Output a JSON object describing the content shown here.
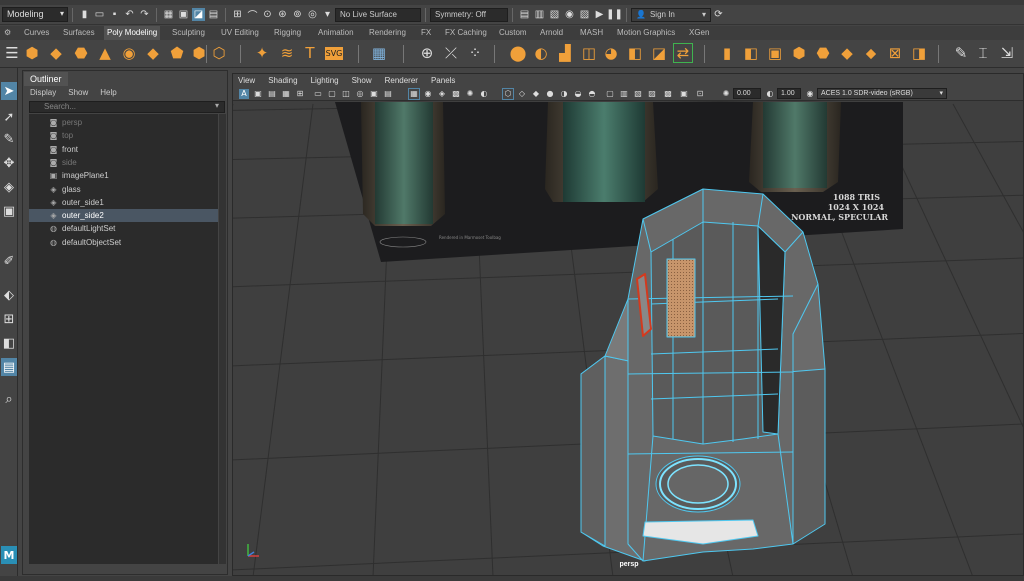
{
  "topbar": {
    "mode": "Modeling",
    "live_surface": "No Live Surface",
    "symmetry": "Symmetry: Off",
    "sign_in": "Sign In"
  },
  "shelf_tabs": [
    "Curves",
    "Surfaces",
    "Poly Modeling",
    "Sculpting",
    "UV Editing",
    "Rigging",
    "Animation",
    "Rendering",
    "FX",
    "FX Caching",
    "Custom",
    "Arnold",
    "MASH",
    "Motion Graphics",
    "XGen"
  ],
  "shelf_active_tab": "Poly Modeling",
  "colors": {
    "selection_blue": "#5285a6",
    "wireframe_cyan": "#4fc8f0",
    "edge_red": "#d33a1e",
    "shelf_orange": "#f0a03a",
    "maya_badge": "#2a8fb5"
  },
  "outliner": {
    "tab": "Outliner",
    "menu": [
      "Display",
      "Show",
      "Help"
    ],
    "search_placeholder": "Search...",
    "items": [
      {
        "label": "persp",
        "icon": "camera-icon",
        "hidden": true,
        "selected": false
      },
      {
        "label": "top",
        "icon": "camera-icon",
        "hidden": true,
        "selected": false
      },
      {
        "label": "front",
        "icon": "camera-icon",
        "hidden": false,
        "selected": false
      },
      {
        "label": "side",
        "icon": "camera-icon",
        "hidden": true,
        "selected": false
      },
      {
        "label": "imagePlane1",
        "icon": "image-plane-icon",
        "hidden": false,
        "selected": false
      },
      {
        "label": "glass",
        "icon": "mesh-icon",
        "hidden": false,
        "selected": false
      },
      {
        "label": "outer_side1",
        "icon": "mesh-icon",
        "hidden": false,
        "selected": false
      },
      {
        "label": "outer_side2",
        "icon": "mesh-icon",
        "hidden": false,
        "selected": true
      },
      {
        "label": "defaultLightSet",
        "icon": "set-icon",
        "hidden": false,
        "selected": false
      },
      {
        "label": "defaultObjectSet",
        "icon": "set-icon",
        "hidden": false,
        "selected": false
      }
    ]
  },
  "viewport": {
    "menu": [
      "View",
      "Shading",
      "Lighting",
      "Show",
      "Renderer",
      "Panels"
    ],
    "exposure": "0.00",
    "gamma": "1.00",
    "color_space": "ACES 1.0 SDR-video (sRGB)",
    "camera": "persp",
    "reference_text_1": "1088 TRIS",
    "reference_text_2": "1024 X 1024",
    "reference_text_3": "NORMAL, SPECULAR",
    "reference_text_small": "Rendered in Marmoset Toolbag"
  },
  "toolbox": {
    "maya_badge": "M"
  }
}
